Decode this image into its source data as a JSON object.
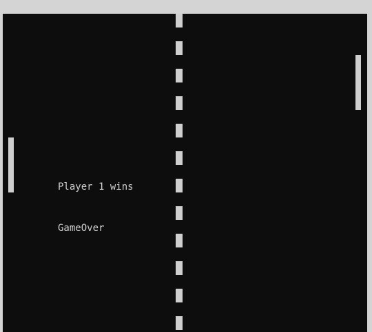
{
  "game": {
    "winner_text": "Player 1 wins",
    "status_text": "GameOver"
  },
  "colors": {
    "background": "#0d0d0d",
    "foreground": "#cfcfcf",
    "window_frame": "#d4d4d4"
  }
}
